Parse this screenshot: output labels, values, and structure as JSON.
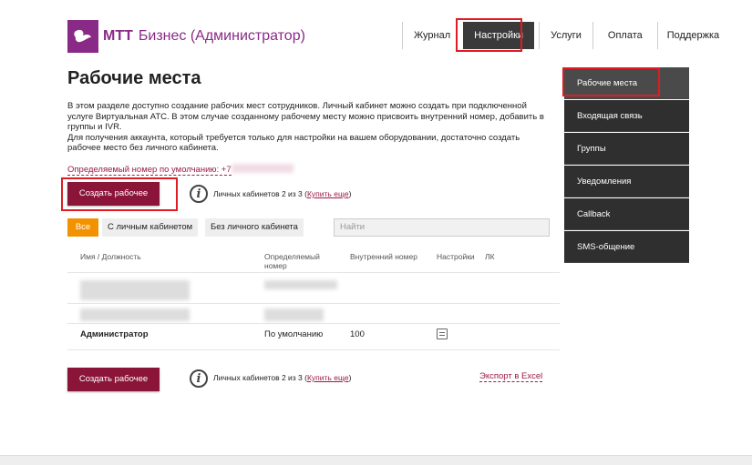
{
  "header": {
    "brand": "МТТ",
    "product": "Бизнес (Администратор)",
    "nav": [
      "Журнал",
      "Настройки",
      "Услуги",
      "Оплата",
      "Поддержка"
    ]
  },
  "main": {
    "title": "Рабочие места",
    "desc1": "В этом разделе доступно создание рабочих мест сотрудников. Личный кабинет можно создать при подключенной услуге Виртуальная АТС. В этом случае созданному рабочему месту можно присвоить внутренний номер, добавить в группы и IVR.",
    "desc2": "Для получения аккаунта, который требуется только для настройки на вашем оборудовании, достаточно создать рабочее место без личного кабинета.",
    "default_number_label": "Определяемый номер по умолчанию: +7",
    "create_button": "Создать рабочее место",
    "cabinets_text": "Личных кабинетов 2 из 3 (",
    "buy_more": "Купить еще",
    "cabinets_close": ")",
    "tabs": [
      "Все",
      "С личным кабинетом",
      "Без личного кабинета"
    ],
    "search_placeholder": "Найти",
    "columns": [
      "Имя / Должность",
      "Определяемый номер",
      "Внутренний номер",
      "Настройки",
      "ЛК"
    ],
    "admin_row": {
      "name": "Администратор",
      "number": "По умолчанию",
      "ext": "100"
    },
    "export": "Экспорт в Excel"
  },
  "sidebar": {
    "items": [
      "Рабочие места",
      "Входящая связь",
      "Группы",
      "Уведомления",
      "Callback",
      "SMS-общение"
    ]
  }
}
